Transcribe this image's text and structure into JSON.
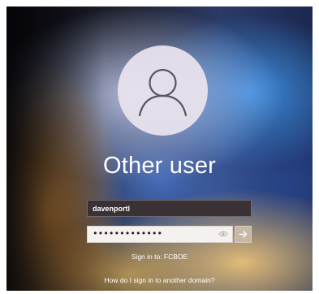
{
  "login": {
    "display_name": "Other user",
    "username_value": "davenportl",
    "password_mask": "•••••••••••••",
    "sign_in_to": "Sign in to: FCBOE",
    "other_domain_link": "How do I sign in to another domain?"
  },
  "icons": {
    "avatar": "person-icon",
    "reveal": "eye-icon",
    "submit": "arrow-right-icon"
  },
  "colors": {
    "avatar_bg": "#e8e2ec",
    "username_field_bg": "#3a3134",
    "password_field_bg": "#f4f1ef",
    "submit_button_bg": "#c8b8a6",
    "text": "#ffffff"
  }
}
